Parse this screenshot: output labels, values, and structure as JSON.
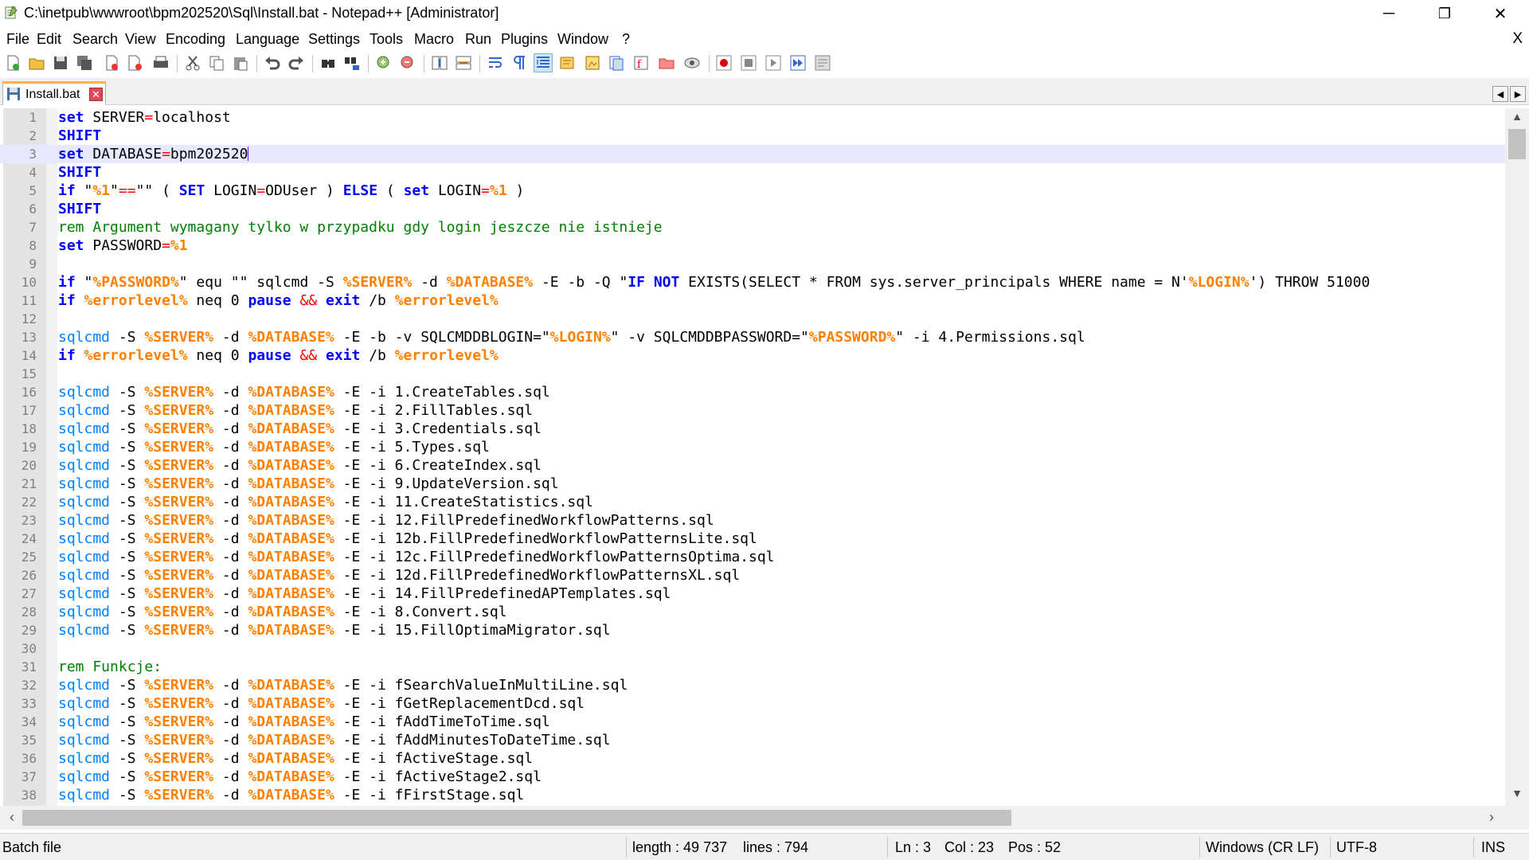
{
  "window": {
    "title": "C:\\inetpub\\wwwroot\\bpm202520\\Sql\\Install.bat - Notepad++ [Administrator]",
    "minimize": "─",
    "maximize": "❐",
    "close": "✕"
  },
  "menu": {
    "items": [
      "File",
      "Edit",
      "Search",
      "View",
      "Encoding",
      "Language",
      "Settings",
      "Tools",
      "Macro",
      "Run",
      "Plugins",
      "Window",
      "?"
    ],
    "close_doc": "X"
  },
  "toolbar": {
    "icons": [
      "new-file",
      "open-file",
      "save",
      "save-all",
      "close",
      "close-all",
      "print",
      "cut",
      "copy",
      "paste",
      "undo",
      "redo",
      "find",
      "replace",
      "zoom-in",
      "zoom-out",
      "sync-vertical",
      "sync-horizontal",
      "word-wrap",
      "show-all-chars",
      "indent-guide",
      "udl",
      "doc-map",
      "doc-list",
      "function-list",
      "folder-workspace",
      "monitoring",
      "record-macro",
      "stop-record",
      "play-macro",
      "run-macro-multiple",
      "save-macro"
    ]
  },
  "tab": {
    "label": "Install.bat",
    "close": "✕",
    "prev": "◀",
    "next": "▶"
  },
  "editor": {
    "current_line": 3,
    "lines": [
      {
        "n": "1",
        "segs": [
          [
            "kw",
            "set"
          ],
          [
            "t",
            " SERVER"
          ],
          [
            "op",
            "="
          ],
          [
            "t",
            "localhost"
          ]
        ]
      },
      {
        "n": "2",
        "segs": [
          [
            "kw",
            "SHIFT"
          ]
        ]
      },
      {
        "n": "3",
        "segs": [
          [
            "kw",
            "set"
          ],
          [
            "t",
            " DATABASE"
          ],
          [
            "op",
            "="
          ],
          [
            "t",
            "bpm202520"
          ]
        ]
      },
      {
        "n": "4",
        "segs": [
          [
            "kw",
            "SHIFT"
          ]
        ]
      },
      {
        "n": "5",
        "segs": [
          [
            "kw",
            "if"
          ],
          [
            "t",
            " \""
          ],
          [
            "var",
            "%1"
          ],
          [
            "t",
            "\""
          ],
          [
            "op",
            "=="
          ],
          [
            "t",
            "\"\" ( "
          ],
          [
            "kw",
            "SET"
          ],
          [
            "t",
            " LOGIN"
          ],
          [
            "op",
            "="
          ],
          [
            "t",
            "ODUser ) "
          ],
          [
            "kw",
            "ELSE"
          ],
          [
            "t",
            " ( "
          ],
          [
            "kw",
            "set"
          ],
          [
            "t",
            " LOGIN"
          ],
          [
            "op",
            "="
          ],
          [
            "var",
            "%1"
          ],
          [
            "t",
            " )"
          ]
        ]
      },
      {
        "n": "6",
        "segs": [
          [
            "kw",
            "SHIFT"
          ]
        ]
      },
      {
        "n": "7",
        "segs": [
          [
            "cm",
            "rem Argument wymagany tylko w przypadku gdy login jeszcze nie istnieje"
          ]
        ]
      },
      {
        "n": "8",
        "segs": [
          [
            "kw",
            "set"
          ],
          [
            "t",
            " PASSWORD"
          ],
          [
            "op",
            "="
          ],
          [
            "var",
            "%1"
          ]
        ]
      },
      {
        "n": "9",
        "segs": []
      },
      {
        "n": "10",
        "segs": [
          [
            "kw",
            "if"
          ],
          [
            "t",
            " \""
          ],
          [
            "var",
            "%PASSWORD%"
          ],
          [
            "t",
            "\" equ \"\" sqlcmd -S "
          ],
          [
            "var",
            "%SERVER%"
          ],
          [
            "t",
            " -d "
          ],
          [
            "var",
            "%DATABASE%"
          ],
          [
            "t",
            " -E -b -Q \""
          ],
          [
            "kw",
            "IF NOT"
          ],
          [
            "t",
            " EXISTS(SELECT * FROM sys.server_principals WHERE name = N'"
          ],
          [
            "var",
            "%LOGIN%"
          ],
          [
            "t",
            "') THROW 51000"
          ]
        ]
      },
      {
        "n": "11",
        "segs": [
          [
            "kw",
            "if"
          ],
          [
            "t",
            " "
          ],
          [
            "var",
            "%errorlevel%"
          ],
          [
            "t",
            " neq 0 "
          ],
          [
            "kw",
            "pause"
          ],
          [
            "t",
            " "
          ],
          [
            "op",
            "&&"
          ],
          [
            "t",
            " "
          ],
          [
            "kw",
            "exit"
          ],
          [
            "t",
            " /b "
          ],
          [
            "var",
            "%errorlevel%"
          ]
        ]
      },
      {
        "n": "12",
        "segs": []
      },
      {
        "n": "13",
        "segs": [
          [
            "cmd",
            "sqlcmd"
          ],
          [
            "t",
            " -S "
          ],
          [
            "var",
            "%SERVER%"
          ],
          [
            "t",
            " -d "
          ],
          [
            "var",
            "%DATABASE%"
          ],
          [
            "t",
            " -E -b -v SQLCMDDBLOGIN=\""
          ],
          [
            "var",
            "%LOGIN%"
          ],
          [
            "t",
            "\" -v SQLCMDDBPASSWORD=\""
          ],
          [
            "var",
            "%PASSWORD%"
          ],
          [
            "t",
            "\" -i 4.Permissions.sql"
          ]
        ]
      },
      {
        "n": "14",
        "segs": [
          [
            "kw",
            "if"
          ],
          [
            "t",
            " "
          ],
          [
            "var",
            "%errorlevel%"
          ],
          [
            "t",
            " neq 0 "
          ],
          [
            "kw",
            "pause"
          ],
          [
            "t",
            " "
          ],
          [
            "op",
            "&&"
          ],
          [
            "t",
            " "
          ],
          [
            "kw",
            "exit"
          ],
          [
            "t",
            " /b "
          ],
          [
            "var",
            "%errorlevel%"
          ]
        ]
      },
      {
        "n": "15",
        "segs": []
      },
      {
        "n": "16",
        "segs": [
          [
            "cmd",
            "sqlcmd"
          ],
          [
            "t",
            " -S "
          ],
          [
            "var",
            "%SERVER%"
          ],
          [
            "t",
            " -d "
          ],
          [
            "var",
            "%DATABASE%"
          ],
          [
            "t",
            " -E -i 1.CreateTables.sql"
          ]
        ]
      },
      {
        "n": "17",
        "segs": [
          [
            "cmd",
            "sqlcmd"
          ],
          [
            "t",
            " -S "
          ],
          [
            "var",
            "%SERVER%"
          ],
          [
            "t",
            " -d "
          ],
          [
            "var",
            "%DATABASE%"
          ],
          [
            "t",
            " -E -i 2.FillTables.sql"
          ]
        ]
      },
      {
        "n": "18",
        "segs": [
          [
            "cmd",
            "sqlcmd"
          ],
          [
            "t",
            " -S "
          ],
          [
            "var",
            "%SERVER%"
          ],
          [
            "t",
            " -d "
          ],
          [
            "var",
            "%DATABASE%"
          ],
          [
            "t",
            " -E -i 3.Credentials.sql"
          ]
        ]
      },
      {
        "n": "19",
        "segs": [
          [
            "cmd",
            "sqlcmd"
          ],
          [
            "t",
            " -S "
          ],
          [
            "var",
            "%SERVER%"
          ],
          [
            "t",
            " -d "
          ],
          [
            "var",
            "%DATABASE%"
          ],
          [
            "t",
            " -E -i 5.Types.sql"
          ]
        ]
      },
      {
        "n": "20",
        "segs": [
          [
            "cmd",
            "sqlcmd"
          ],
          [
            "t",
            " -S "
          ],
          [
            "var",
            "%SERVER%"
          ],
          [
            "t",
            " -d "
          ],
          [
            "var",
            "%DATABASE%"
          ],
          [
            "t",
            " -E -i 6.CreateIndex.sql"
          ]
        ]
      },
      {
        "n": "21",
        "segs": [
          [
            "cmd",
            "sqlcmd"
          ],
          [
            "t",
            " -S "
          ],
          [
            "var",
            "%SERVER%"
          ],
          [
            "t",
            " -d "
          ],
          [
            "var",
            "%DATABASE%"
          ],
          [
            "t",
            " -E -i 9.UpdateVersion.sql"
          ]
        ]
      },
      {
        "n": "22",
        "segs": [
          [
            "cmd",
            "sqlcmd"
          ],
          [
            "t",
            " -S "
          ],
          [
            "var",
            "%SERVER%"
          ],
          [
            "t",
            " -d "
          ],
          [
            "var",
            "%DATABASE%"
          ],
          [
            "t",
            " -E -i 11.CreateStatistics.sql"
          ]
        ]
      },
      {
        "n": "23",
        "segs": [
          [
            "cmd",
            "sqlcmd"
          ],
          [
            "t",
            " -S "
          ],
          [
            "var",
            "%SERVER%"
          ],
          [
            "t",
            " -d "
          ],
          [
            "var",
            "%DATABASE%"
          ],
          [
            "t",
            " -E -i 12.FillPredefinedWorkflowPatterns.sql"
          ]
        ]
      },
      {
        "n": "24",
        "segs": [
          [
            "cmd",
            "sqlcmd"
          ],
          [
            "t",
            " -S "
          ],
          [
            "var",
            "%SERVER%"
          ],
          [
            "t",
            " -d "
          ],
          [
            "var",
            "%DATABASE%"
          ],
          [
            "t",
            " -E -i 12b.FillPredefinedWorkflowPatternsLite.sql"
          ]
        ]
      },
      {
        "n": "25",
        "segs": [
          [
            "cmd",
            "sqlcmd"
          ],
          [
            "t",
            " -S "
          ],
          [
            "var",
            "%SERVER%"
          ],
          [
            "t",
            " -d "
          ],
          [
            "var",
            "%DATABASE%"
          ],
          [
            "t",
            " -E -i 12c.FillPredefinedWorkflowPatternsOptima.sql"
          ]
        ]
      },
      {
        "n": "26",
        "segs": [
          [
            "cmd",
            "sqlcmd"
          ],
          [
            "t",
            " -S "
          ],
          [
            "var",
            "%SERVER%"
          ],
          [
            "t",
            " -d "
          ],
          [
            "var",
            "%DATABASE%"
          ],
          [
            "t",
            " -E -i 12d.FillPredefinedWorkflowPatternsXL.sql"
          ]
        ]
      },
      {
        "n": "27",
        "segs": [
          [
            "cmd",
            "sqlcmd"
          ],
          [
            "t",
            " -S "
          ],
          [
            "var",
            "%SERVER%"
          ],
          [
            "t",
            " -d "
          ],
          [
            "var",
            "%DATABASE%"
          ],
          [
            "t",
            " -E -i 14.FillPredefinedAPTemplates.sql"
          ]
        ]
      },
      {
        "n": "28",
        "segs": [
          [
            "cmd",
            "sqlcmd"
          ],
          [
            "t",
            " -S "
          ],
          [
            "var",
            "%SERVER%"
          ],
          [
            "t",
            " -d "
          ],
          [
            "var",
            "%DATABASE%"
          ],
          [
            "t",
            " -E -i 8.Convert.sql"
          ]
        ]
      },
      {
        "n": "29",
        "segs": [
          [
            "cmd",
            "sqlcmd"
          ],
          [
            "t",
            " -S "
          ],
          [
            "var",
            "%SERVER%"
          ],
          [
            "t",
            " -d "
          ],
          [
            "var",
            "%DATABASE%"
          ],
          [
            "t",
            " -E -i 15.FillOptimaMigrator.sql"
          ]
        ]
      },
      {
        "n": "30",
        "segs": []
      },
      {
        "n": "31",
        "segs": [
          [
            "cm",
            "rem Funkcje:"
          ]
        ]
      },
      {
        "n": "32",
        "segs": [
          [
            "cmd",
            "sqlcmd"
          ],
          [
            "t",
            " -S "
          ],
          [
            "var",
            "%SERVER%"
          ],
          [
            "t",
            " -d "
          ],
          [
            "var",
            "%DATABASE%"
          ],
          [
            "t",
            " -E -i fSearchValueInMultiLine.sql"
          ]
        ]
      },
      {
        "n": "33",
        "segs": [
          [
            "cmd",
            "sqlcmd"
          ],
          [
            "t",
            " -S "
          ],
          [
            "var",
            "%SERVER%"
          ],
          [
            "t",
            " -d "
          ],
          [
            "var",
            "%DATABASE%"
          ],
          [
            "t",
            " -E -i fGetReplacementDcd.sql"
          ]
        ]
      },
      {
        "n": "34",
        "segs": [
          [
            "cmd",
            "sqlcmd"
          ],
          [
            "t",
            " -S "
          ],
          [
            "var",
            "%SERVER%"
          ],
          [
            "t",
            " -d "
          ],
          [
            "var",
            "%DATABASE%"
          ],
          [
            "t",
            " -E -i fAddTimeToTime.sql"
          ]
        ]
      },
      {
        "n": "35",
        "segs": [
          [
            "cmd",
            "sqlcmd"
          ],
          [
            "t",
            " -S "
          ],
          [
            "var",
            "%SERVER%"
          ],
          [
            "t",
            " -d "
          ],
          [
            "var",
            "%DATABASE%"
          ],
          [
            "t",
            " -E -i fAddMinutesToDateTime.sql"
          ]
        ]
      },
      {
        "n": "36",
        "segs": [
          [
            "cmd",
            "sqlcmd"
          ],
          [
            "t",
            " -S "
          ],
          [
            "var",
            "%SERVER%"
          ],
          [
            "t",
            " -d "
          ],
          [
            "var",
            "%DATABASE%"
          ],
          [
            "t",
            " -E -i fActiveStage.sql"
          ]
        ]
      },
      {
        "n": "37",
        "segs": [
          [
            "cmd",
            "sqlcmd"
          ],
          [
            "t",
            " -S "
          ],
          [
            "var",
            "%SERVER%"
          ],
          [
            "t",
            " -d "
          ],
          [
            "var",
            "%DATABASE%"
          ],
          [
            "t",
            " -E -i fActiveStage2.sql"
          ]
        ]
      },
      {
        "n": "38",
        "segs": [
          [
            "cmd",
            "sqlcmd"
          ],
          [
            "t",
            " -S "
          ],
          [
            "var",
            "%SERVER%"
          ],
          [
            "t",
            " -d "
          ],
          [
            "var",
            "%DATABASE%"
          ],
          [
            "t",
            " -E -i fFirstStage.sql"
          ]
        ]
      }
    ]
  },
  "status": {
    "file_type": "Batch file",
    "length": "length : 49 737",
    "lines": "lines : 794",
    "ln": "Ln : 3",
    "col": "Col : 23",
    "pos": "Pos : 52",
    "eol": "Windows (CR LF)",
    "encoding": "UTF-8",
    "mode": "INS"
  },
  "colors": {
    "keyword": "#0000ff",
    "variable": "#ff8000",
    "command": "#0080ff",
    "comment": "#008000",
    "operator": "#ff0000",
    "current_line": "#e8e8ff",
    "tab_accent": "#fab44a"
  }
}
